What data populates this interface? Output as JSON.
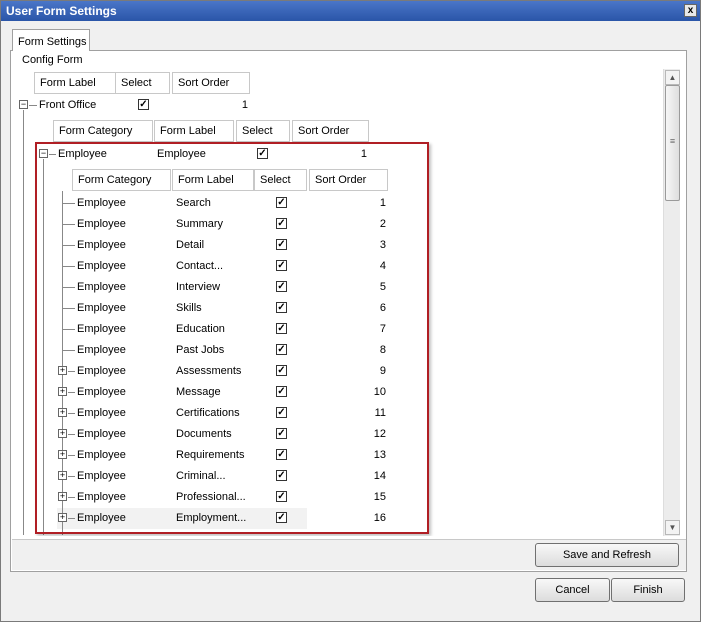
{
  "window": {
    "title": "User Form Settings",
    "close_glyph": "x"
  },
  "tab": {
    "label": "Form Settings"
  },
  "group": {
    "label": "Config Form"
  },
  "top_headers": [
    "Form Label",
    "Select",
    "Sort Order"
  ],
  "front_office": {
    "label": "Front Office",
    "checked": true,
    "sort_order": "1"
  },
  "second_headers": [
    "Form Category",
    "Form Label",
    "Select",
    "Sort Order"
  ],
  "employee_group": {
    "category": "Employee",
    "label": "Employee",
    "checked": true,
    "sort_order": "1"
  },
  "inner_headers": [
    "Form Category",
    "Form Label",
    "Select",
    "Sort Order"
  ],
  "rows": [
    {
      "category": "Employee",
      "label": "Search",
      "checked": true,
      "sort_order": "1",
      "expandable": false
    },
    {
      "category": "Employee",
      "label": "Summary",
      "checked": true,
      "sort_order": "2",
      "expandable": false
    },
    {
      "category": "Employee",
      "label": "Detail",
      "checked": true,
      "sort_order": "3",
      "expandable": false
    },
    {
      "category": "Employee",
      "label": "Contact...",
      "checked": true,
      "sort_order": "4",
      "expandable": false
    },
    {
      "category": "Employee",
      "label": "Interview",
      "checked": true,
      "sort_order": "5",
      "expandable": false
    },
    {
      "category": "Employee",
      "label": "Skills",
      "checked": true,
      "sort_order": "6",
      "expandable": false
    },
    {
      "category": "Employee",
      "label": "Education",
      "checked": true,
      "sort_order": "7",
      "expandable": false
    },
    {
      "category": "Employee",
      "label": "Past Jobs",
      "checked": true,
      "sort_order": "8",
      "expandable": false
    },
    {
      "category": "Employee",
      "label": "Assessments",
      "checked": true,
      "sort_order": "9",
      "expandable": true
    },
    {
      "category": "Employee",
      "label": "Message",
      "checked": true,
      "sort_order": "10",
      "expandable": true
    },
    {
      "category": "Employee",
      "label": "Certifications",
      "checked": true,
      "sort_order": "11",
      "expandable": true
    },
    {
      "category": "Employee",
      "label": "Documents",
      "checked": true,
      "sort_order": "12",
      "expandable": true
    },
    {
      "category": "Employee",
      "label": "Requirements",
      "checked": true,
      "sort_order": "13",
      "expandable": true
    },
    {
      "category": "Employee",
      "label": "Criminal...",
      "checked": true,
      "sort_order": "14",
      "expandable": true
    },
    {
      "category": "Employee",
      "label": "Professional...",
      "checked": true,
      "sort_order": "15",
      "expandable": true
    },
    {
      "category": "Employee",
      "label": "Employment...",
      "checked": true,
      "sort_order": "16",
      "expandable": true
    }
  ],
  "buttons": {
    "save_refresh": "Save and Refresh",
    "cancel": "Cancel",
    "finish": "Finish"
  },
  "glyphs": {
    "check": "✓",
    "collapse": "−",
    "expand": "+"
  },
  "colors": {
    "highlight_border": "#b01e24",
    "titlebar": "#2a55a8"
  }
}
